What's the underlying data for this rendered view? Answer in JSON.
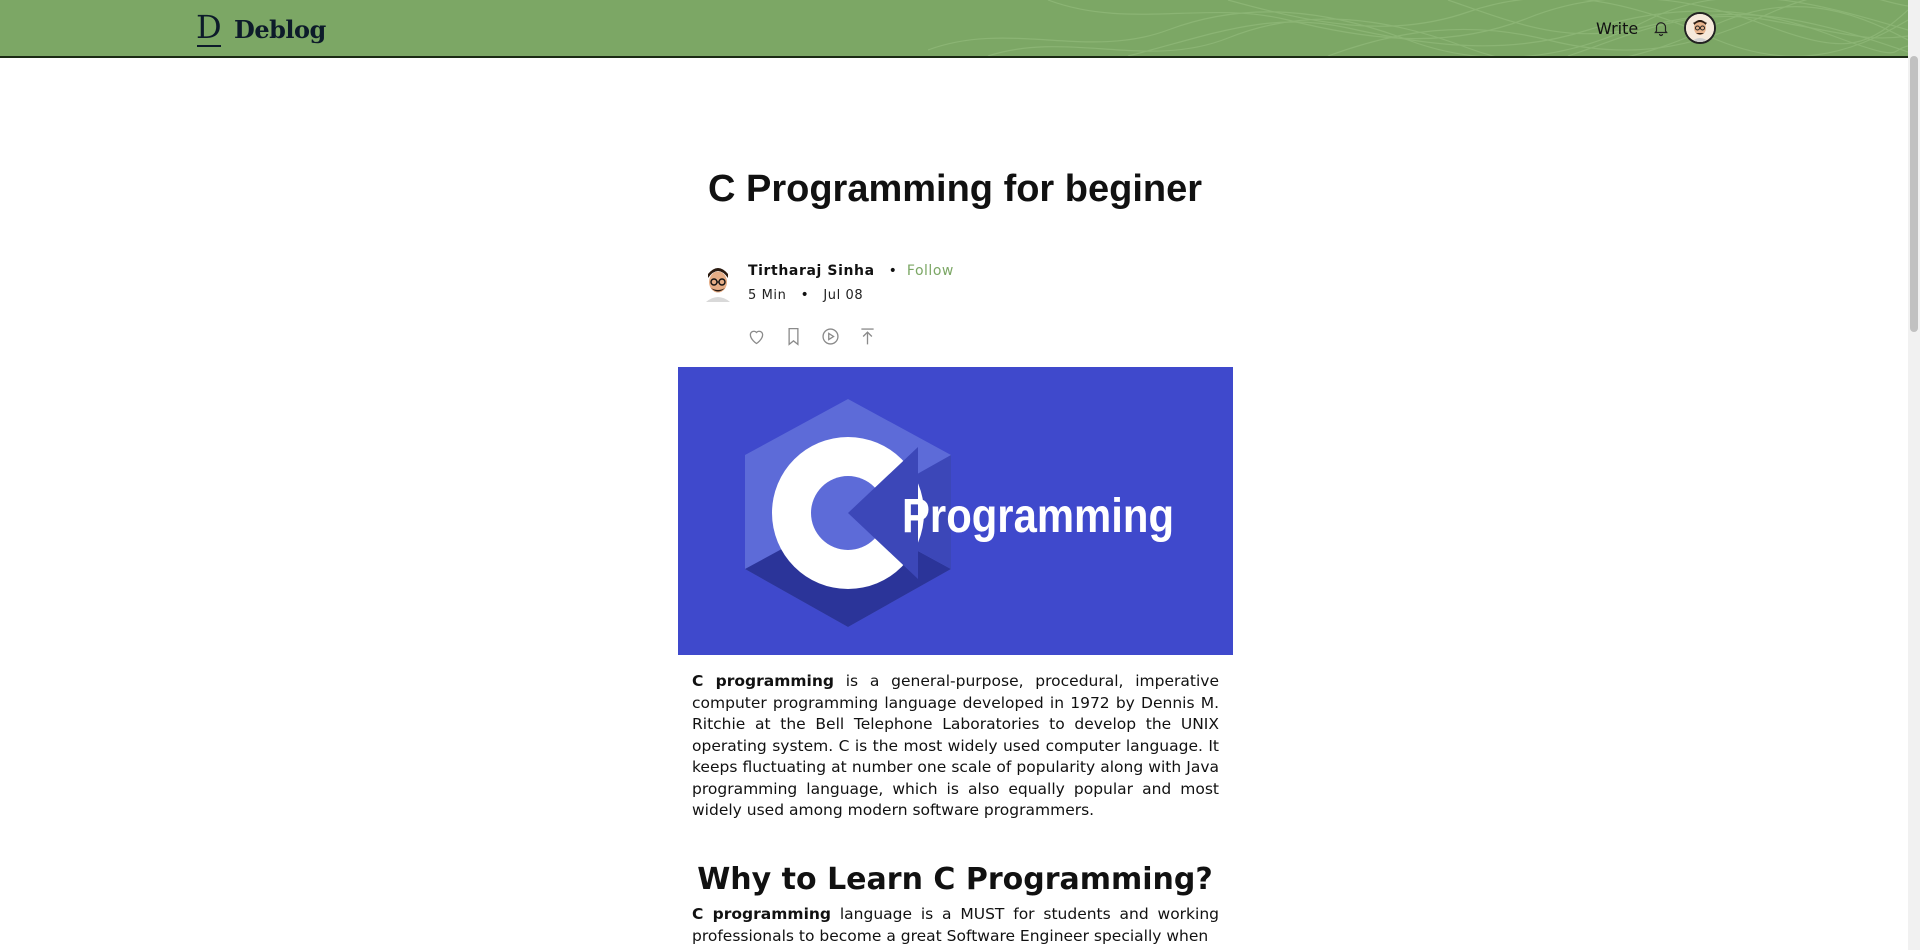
{
  "header": {
    "logo_text": "Deblog",
    "write_label": "Write",
    "bell_icon": "bell-icon",
    "avatar_icon": "user-avatar-icon"
  },
  "article": {
    "title": "C Programming for beginer",
    "author": {
      "name": "Tirtharaj Sinha",
      "follow_label": "Follow",
      "read_time": "5 Min",
      "date": "Jul 08"
    },
    "actions": [
      "heart-icon",
      "bookmark-icon",
      "play-icon",
      "share-icon"
    ],
    "cover_text": "Programming",
    "cover_letter": "C",
    "p1_bold": "C programming",
    "p1_rest": " is a general-purpose, procedural, imperative computer programming language developed in 1972 by Dennis M. Ritchie at the Bell Telephone Laboratories to develop the UNIX operating system. C is the most widely used computer language. It keeps fluctuating at number one scale of popularity along with Java programming language, which is also equally popular and most widely used among modern software programmers.",
    "section_heading": "Why to Learn C Programming?",
    "p2_bold": "C programming",
    "p2_rest": " language is a MUST for students and working professionals to become a great Software Engineer specially when"
  },
  "colors": {
    "header_green": "#7ca765",
    "cover_blue": "#3f49cc",
    "follow_green": "#7ca765"
  }
}
